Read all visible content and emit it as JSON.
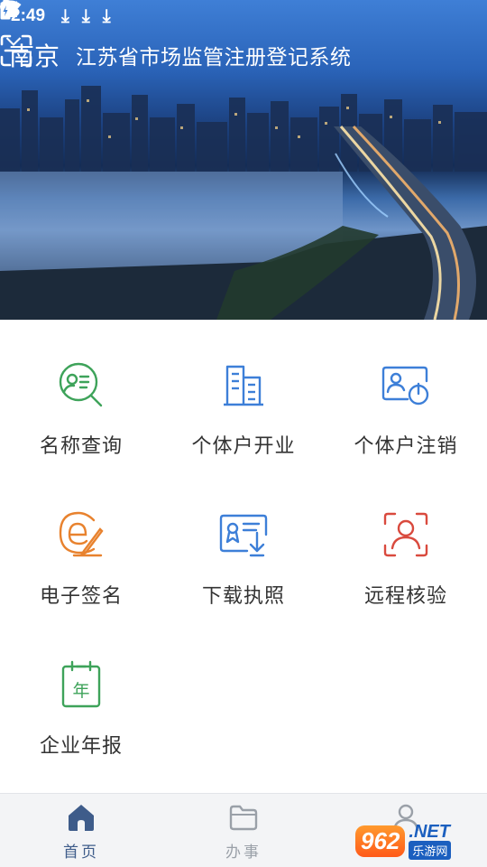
{
  "status_bar": {
    "time": "2:49",
    "download_glyphs": [
      "⤓",
      "⤓",
      "⤓"
    ]
  },
  "header": {
    "city": "南京",
    "title": "江苏省市场监管注册登记系统"
  },
  "services": [
    {
      "label": "名称查询",
      "icon": "name-search-icon",
      "color": "#3ea35a"
    },
    {
      "label": "个体户开业",
      "icon": "building-icon",
      "color": "#3d7fd8"
    },
    {
      "label": "个体户注销",
      "icon": "user-power-icon",
      "color": "#3d7fd8"
    },
    {
      "label": "电子签名",
      "icon": "e-sign-icon",
      "color": "#e8822e"
    },
    {
      "label": "下载执照",
      "icon": "license-download-icon",
      "color": "#3d7fd8"
    },
    {
      "label": "远程核验",
      "icon": "face-verify-icon",
      "color": "#d94a3e"
    },
    {
      "label": "企业年报",
      "icon": "annual-report-icon",
      "color": "#3ea35a"
    }
  ],
  "bottom_nav": {
    "home": "首页",
    "tasks": "办事",
    "active_color": "#3e5c8a",
    "inactive_color": "#9aa0a8"
  },
  "watermark": {
    "badge": "962",
    "net": ".NET",
    "cn": "乐游网"
  }
}
